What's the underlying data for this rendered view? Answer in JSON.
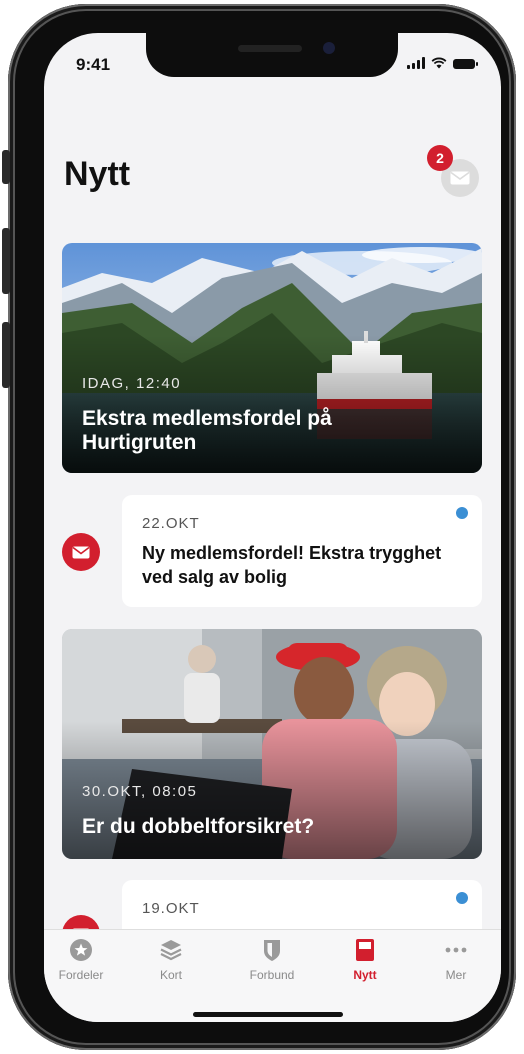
{
  "status_bar": {
    "time": "9:41"
  },
  "header": {
    "title": "Nytt",
    "unread_count": "2"
  },
  "feed": [
    {
      "kind": "image",
      "date": "IDAG, 12:40",
      "title": "Ekstra medlemsfordel på Hurtigruten"
    },
    {
      "kind": "text",
      "date": "22.OKT",
      "title": "Ny medlemsfordel! Ekstra trygghet ved salg av bolig",
      "unread": true
    },
    {
      "kind": "image",
      "date": "30.OKT, 08:05",
      "title": "Er du dobbeltforsikret?"
    },
    {
      "kind": "text",
      "date": "19.OKT",
      "unread": true
    }
  ],
  "tabbar": {
    "items": [
      {
        "label": "Fordeler",
        "icon": "star-badge-icon"
      },
      {
        "label": "Kort",
        "icon": "cards-stack-icon"
      },
      {
        "label": "Forbund",
        "icon": "shield-icon"
      },
      {
        "label": "Nytt",
        "icon": "news-icon",
        "active": true
      },
      {
        "label": "Mer",
        "icon": "more-dots-icon"
      }
    ]
  },
  "colors": {
    "accent": "#d21f2e",
    "unread": "#3b8fd4"
  }
}
